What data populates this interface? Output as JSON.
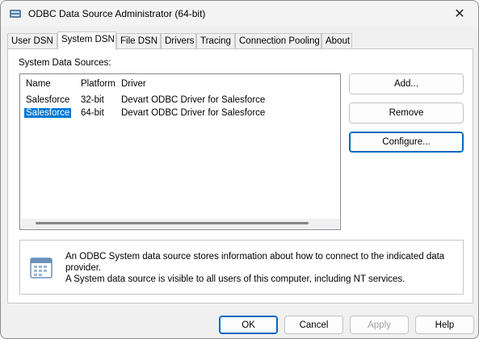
{
  "window": {
    "title": "ODBC Data Source Administrator (64-bit)",
    "close_glyph": "✕"
  },
  "tabs": [
    {
      "label": "User DSN"
    },
    {
      "label": "System DSN"
    },
    {
      "label": "File DSN"
    },
    {
      "label": "Drivers"
    },
    {
      "label": "Tracing"
    },
    {
      "label": "Connection Pooling"
    },
    {
      "label": "About"
    }
  ],
  "active_tab": "System DSN",
  "system_dsn": {
    "section_label": "System Data Sources:",
    "columns": [
      "Name",
      "Platform",
      "Driver"
    ],
    "rows": [
      {
        "name": "Salesforce",
        "platform": "32-bit",
        "driver": "Devart ODBC Driver for Salesforce",
        "selected": false
      },
      {
        "name": "Salesforce",
        "platform": "64-bit",
        "driver": "Devart ODBC Driver for Salesforce",
        "selected": true
      }
    ],
    "buttons": {
      "add": "Add...",
      "remove": "Remove",
      "configure": "Configure..."
    },
    "info": {
      "line1": "An ODBC System data source stores information about how to connect to the indicated data provider.",
      "line2": "A System data source is visible to all users of this computer, including NT services."
    }
  },
  "footer": {
    "ok": "OK",
    "cancel": "Cancel",
    "apply": "Apply",
    "help": "Help"
  },
  "colors": {
    "selection": "#0078d7",
    "default_button_border": "#0067c0"
  }
}
